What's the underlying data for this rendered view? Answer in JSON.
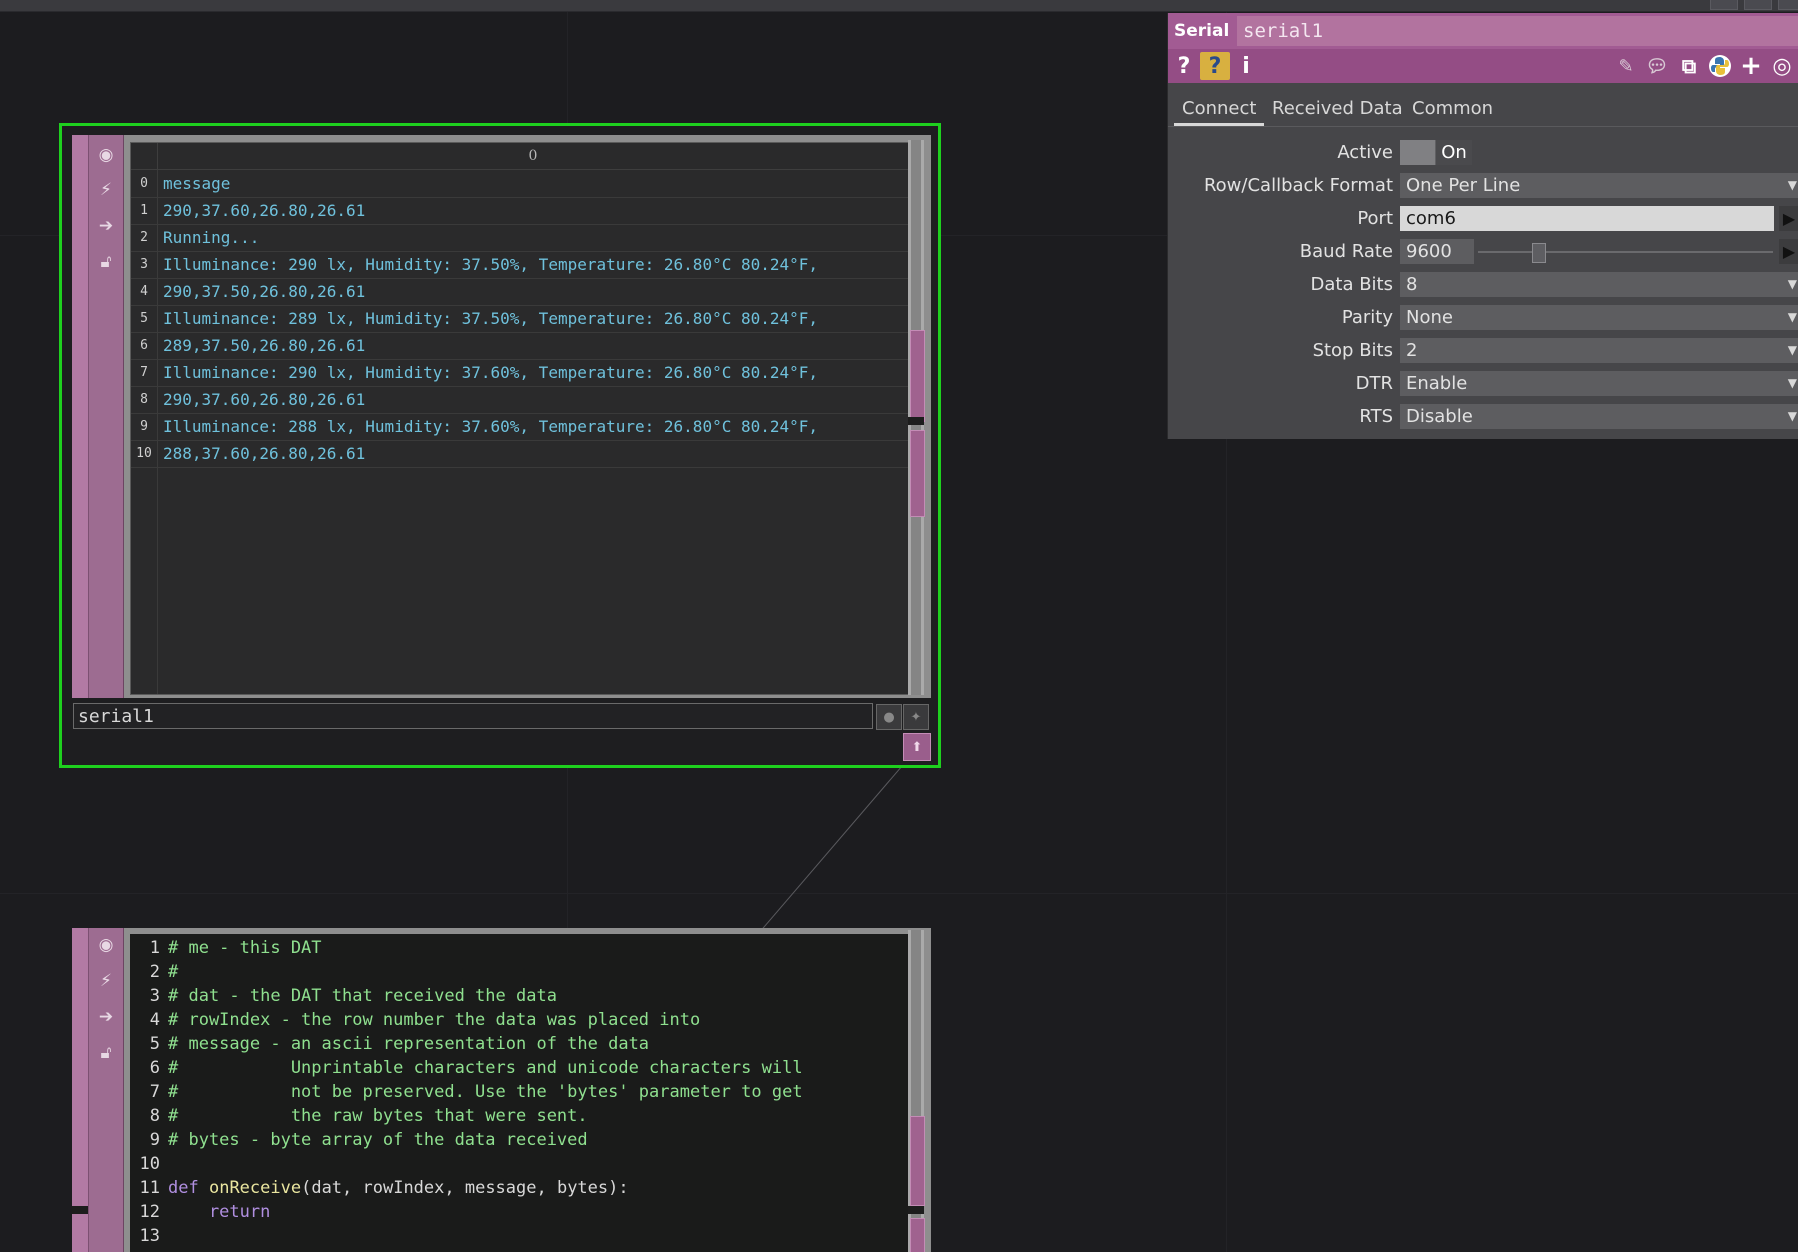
{
  "serial_dat": {
    "column_header": "0",
    "rows": [
      {
        "index": "0",
        "value": "message"
      },
      {
        "index": "1",
        "value": "290,37.60,26.80,26.61"
      },
      {
        "index": "2",
        "value": "Running..."
      },
      {
        "index": "3",
        "value": "Illuminance: 290 lx, Humidity: 37.50%, Temperature: 26.80°C 80.24°F,"
      },
      {
        "index": "4",
        "value": "290,37.50,26.80,26.61"
      },
      {
        "index": "5",
        "value": "Illuminance: 289 lx, Humidity: 37.50%, Temperature: 26.80°C 80.24°F,"
      },
      {
        "index": "6",
        "value": "289,37.50,26.80,26.61"
      },
      {
        "index": "7",
        "value": "Illuminance: 290 lx, Humidity: 37.60%, Temperature: 26.80°C 80.24°F,"
      },
      {
        "index": "8",
        "value": "290,37.60,26.80,26.61"
      },
      {
        "index": "9",
        "value": "Illuminance: 288 lx, Humidity: 37.60%, Temperature: 26.80°C 80.24°F,"
      },
      {
        "index": "10",
        "value": "288,37.60,26.80,26.61"
      }
    ],
    "node_name": "serial1",
    "tool_icons": [
      "viewer-icon",
      "bypass-icon",
      "export-icon",
      "lock-icon"
    ]
  },
  "callbacks_dat": {
    "lines": [
      {
        "n": "1",
        "text": "# me - this DAT"
      },
      {
        "n": "2",
        "text": "#"
      },
      {
        "n": "3",
        "text": "# dat - the DAT that received the data"
      },
      {
        "n": "4",
        "text": "# rowIndex - the row number the data was placed into"
      },
      {
        "n": "5",
        "text": "# message - an ascii representation of the data"
      },
      {
        "n": "6",
        "text": "#           Unprintable characters and unicode characters will"
      },
      {
        "n": "7",
        "text": "#           not be preserved. Use the 'bytes' parameter to get"
      },
      {
        "n": "8",
        "text": "#           the raw bytes that were sent."
      },
      {
        "n": "9",
        "text": "# bytes - byte array of the data received"
      },
      {
        "n": "10",
        "text": ""
      },
      {
        "n": "11",
        "kw": "def",
        "fn": "onReceive",
        "rest": "(dat, rowIndex, message, bytes):"
      },
      {
        "n": "12",
        "kw": "    return",
        "fn": "",
        "rest": ""
      },
      {
        "n": "13",
        "text": ""
      }
    ]
  },
  "params": {
    "op_type": "Serial",
    "op_name": "serial1",
    "header_icons": [
      "help-icon",
      "python-help-icon",
      "info-icon",
      "edit-icon",
      "comment-icon",
      "clone-icon",
      "python-icon",
      "add-icon",
      "target-icon"
    ],
    "tabs": [
      "Connect",
      "Received Data",
      "Common"
    ],
    "active_tab": "Connect",
    "fields": {
      "active_label": "Active",
      "active_value": "On",
      "row_format_label": "Row/Callback Format",
      "row_format_value": "One Per Line",
      "port_label": "Port",
      "port_value": "com6",
      "baud_label": "Baud Rate",
      "baud_value": "9600",
      "databits_label": "Data Bits",
      "databits_value": "8",
      "parity_label": "Parity",
      "parity_value": "None",
      "stopbits_label": "Stop Bits",
      "stopbits_value": "2",
      "dtr_label": "DTR",
      "dtr_value": "Enable",
      "rts_label": "RTS",
      "rts_value": "Disable"
    }
  },
  "colors": {
    "selection": "#1ed01e",
    "dat_accent": "#a25b93",
    "table_text": "#6fc1dc",
    "comment_text": "#8fe08f"
  }
}
